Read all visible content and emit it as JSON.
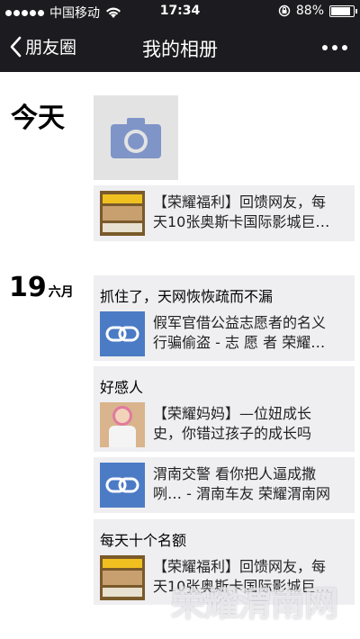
{
  "status_bar": {
    "carrier": "中国移动",
    "time": "17:34",
    "battery": "88%",
    "battery_level": 0.88
  },
  "nav": {
    "back_label": "朋友圈",
    "title": "我的相册"
  },
  "sections": [
    {
      "date": "今天",
      "items": [
        {
          "type": "camera",
          "icon": "camera-icon"
        },
        {
          "type": "shared",
          "text_line1": "【荣耀福利】回馈网友，每",
          "text_line2": "天10张奥斯卡国际影城巨…"
        }
      ]
    },
    {
      "day": "19",
      "month": "六月",
      "items": [
        {
          "caption": "抓住了，天网恢恢疏而不漏",
          "text_line1": "假军官借公益志愿者的名义",
          "text_line2": "行骗偷盗 - 志 愿 者 荣耀…",
          "icon": "link-icon"
        },
        {
          "caption": "好感人",
          "text_line1": "【荣耀妈妈】—位妞成长",
          "text_line2": "史，你错过孩子的成长吗"
        },
        {
          "text_line1": "渭南交警 看你把人逼成撒",
          "text_line2": "咧… - 渭南车友 荣耀渭南网",
          "icon": "link-icon"
        },
        {
          "caption": "每天十个名额",
          "text_line1": "【荣耀福利】回馈网友，每",
          "text_line2": "天10张奥斯卡国际影城巨…"
        }
      ]
    }
  ],
  "watermark": "荣耀渭南网"
}
